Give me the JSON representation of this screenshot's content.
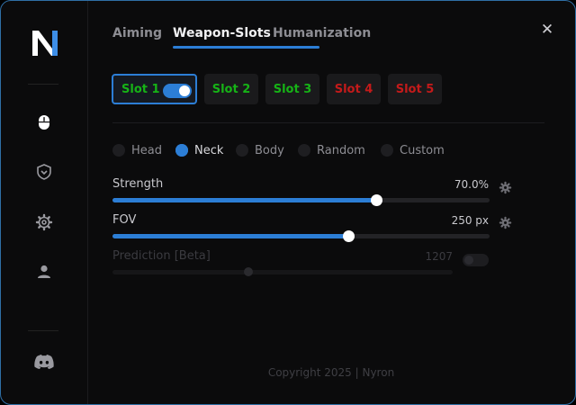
{
  "tabs": [
    {
      "label": "Aiming"
    },
    {
      "label": "Weapon-Slots"
    },
    {
      "label": "Humanization"
    }
  ],
  "close_glyph": "✕",
  "slots": [
    {
      "label": "Slot 1",
      "color": "#16b316",
      "active": true,
      "toggle_on": true
    },
    {
      "label": "Slot 2",
      "color": "#16b316"
    },
    {
      "label": "Slot 3",
      "color": "#16b316"
    },
    {
      "label": "Slot 4",
      "color": "#c41a1a"
    },
    {
      "label": "Slot 5",
      "color": "#c41a1a"
    }
  ],
  "targets": [
    {
      "label": "Head",
      "selected": false
    },
    {
      "label": "Neck",
      "selected": true
    },
    {
      "label": "Body",
      "selected": false
    },
    {
      "label": "Random",
      "selected": false
    },
    {
      "label": "Custom",
      "selected": false
    }
  ],
  "sliders": {
    "strength": {
      "label": "Strength",
      "value": "70.0%",
      "fraction": 0.7
    },
    "fov": {
      "label": "FOV",
      "value": "250 px",
      "fraction": 0.625
    },
    "prediction": {
      "label": "Prediction [Beta]",
      "value": "1207",
      "fraction": 0.4,
      "enabled": false
    }
  },
  "footer": {
    "copyright": "Copyright 2025 | Nyron"
  },
  "colors": {
    "accent": "#2c7ed6",
    "slot_green": "#16b316",
    "slot_red": "#c41a1a",
    "border": "#2f6fa6"
  },
  "sidebar": {
    "icons": [
      "mouse-icon",
      "shield-icon",
      "gear-icon",
      "user-icon",
      "discord-icon"
    ]
  }
}
